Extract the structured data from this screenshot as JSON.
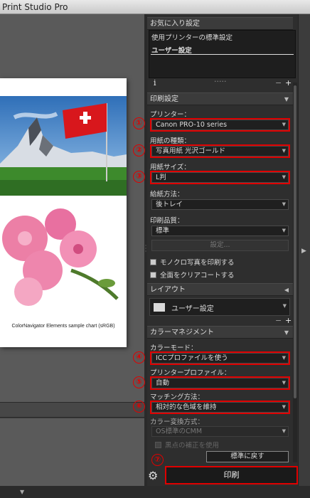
{
  "window": {
    "title": "Print Studio Pro"
  },
  "preview": {
    "caption": "ColorNavigator Elements sample chart (sRGB)"
  },
  "favorites": {
    "header": "お気に入り設定",
    "items": [
      "使用プリンターの標準設定",
      "ユーザー設定"
    ],
    "selected_index": 1,
    "info_icon": "i",
    "remove_label": "−",
    "add_label": "+"
  },
  "print_settings": {
    "header": "印刷設定",
    "printer": {
      "label": "プリンター：",
      "value": "Canon PRO-10 series",
      "marker": "①"
    },
    "paper_type": {
      "label": "用紙の種類：",
      "value": "写真用紙 光沢ゴールド",
      "marker": "②"
    },
    "paper_size": {
      "label": "用紙サイズ：",
      "value": "L判",
      "marker": "③"
    },
    "paper_source": {
      "label": "給紙方法：",
      "value": "後トレイ"
    },
    "quality": {
      "label": "印刷品質：",
      "value": "標準"
    },
    "settings_button": "設定...",
    "monochrome": "モノクロ写真を印刷する",
    "clear_coat": "全面をクリアコートする"
  },
  "layout": {
    "header": "レイアウト",
    "value": "ユーザー設定",
    "remove_label": "−",
    "add_label": "+"
  },
  "color_management": {
    "header": "カラーマネジメント",
    "color_mode": {
      "label": "カラーモード：",
      "value": "ICCプロファイルを使う",
      "marker": "④"
    },
    "printer_profile": {
      "label": "プリンタープロファイル：",
      "value": "自動",
      "marker": "⑤"
    },
    "matching": {
      "label": "マッチング方法：",
      "value": "相対的な色域を維持",
      "marker": "⑥"
    },
    "conversion": {
      "label": "カラー変換方式：",
      "value": "OS標準のCMM"
    },
    "black_point": "黒点の補正を使用",
    "reset_button": "標準に戻す"
  },
  "footer": {
    "print_button": "印刷",
    "print_marker": "⑦"
  },
  "colors": {
    "highlight": "#e00000",
    "panel_bg": "#2e2e2e"
  }
}
